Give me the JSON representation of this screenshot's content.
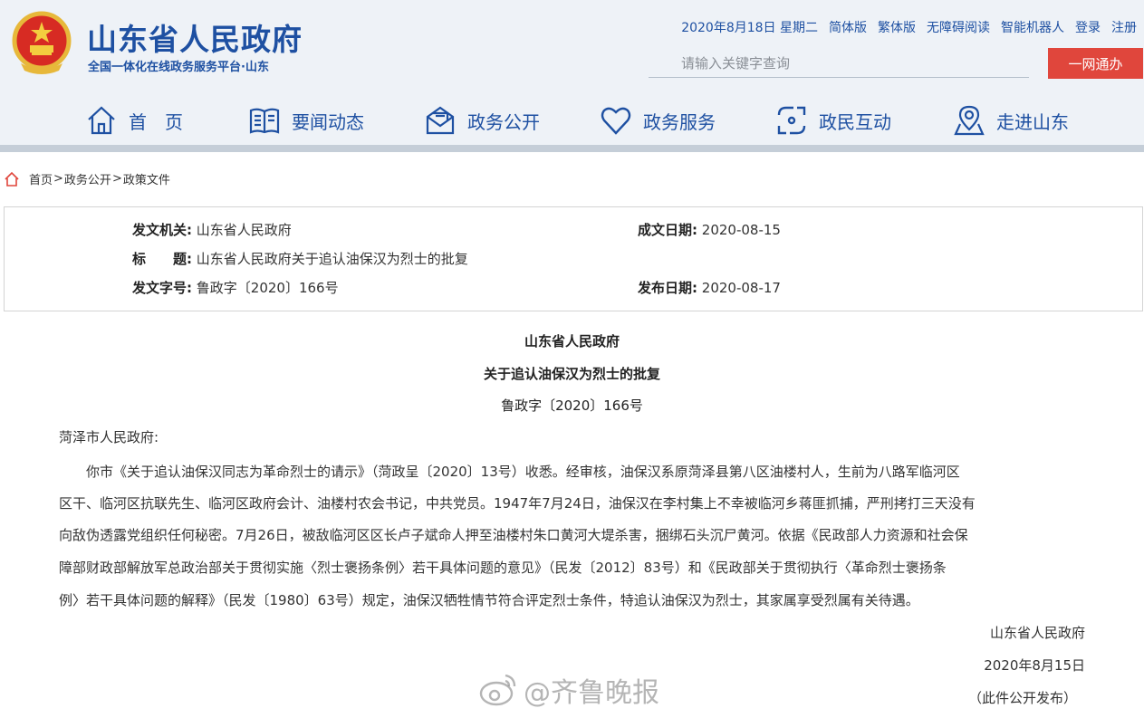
{
  "header": {
    "title": "山东省人民政府",
    "subtitle": "全国一体化在线政务服务平台·山东",
    "date": "2020年8月18日 星期二",
    "links": [
      "简体版",
      "繁体版",
      "无障碍阅读",
      "智能机器人",
      "登录",
      "注册"
    ],
    "search_placeholder": "请输入关键字查询",
    "go_button": "一网通办"
  },
  "nav": [
    {
      "label": "首　页",
      "icon": "home-icon"
    },
    {
      "label": "要闻动态",
      "icon": "book-icon"
    },
    {
      "label": "政务公开",
      "icon": "mail-icon"
    },
    {
      "label": "政务服务",
      "icon": "heart-icon"
    },
    {
      "label": "政民互动",
      "icon": "interact-icon"
    },
    {
      "label": "走进山东",
      "icon": "map-pin-icon"
    }
  ],
  "breadcrumb": [
    "首页",
    "政务公开",
    "政策文件"
  ],
  "meta": {
    "issuer_label": "发文机关:",
    "issuer": "山东省人民政府",
    "written_label": "成文日期:",
    "written": "2020-08-15",
    "title_label": "标　　题:",
    "title": "山东省人民政府关于追认油保汉为烈士的批复",
    "docno_label": "发文字号:",
    "docno": "鲁政字〔2020〕166号",
    "published_label": "发布日期:",
    "published": "2020-08-17"
  },
  "document": {
    "heading1": "山东省人民政府",
    "heading2": "关于追认油保汉为烈士的批复",
    "docno": "鲁政字〔2020〕166号",
    "salutation": "菏泽市人民政府:",
    "lines": [
      "　　你市《关于追认油保汉同志为革命烈士的请示》（菏政呈〔2020〕13号）收悉。经审核，油保汉系原菏泽县第八区油楼村人，生前为八路军临河区",
      "区干、临河区抗联先生、临河区政府会计、油楼村农会书记，中共党员。1947年7月24日，油保汉在李村集上不幸被临河乡蒋匪抓捕，严刑拷打三天没有",
      "向敌伪透露党组织任何秘密。7月26日，被敌临河区区长卢子斌命人押至油楼村朱口黄河大堤杀害，捆绑石头沉尸黄河。依据《民政部人力资源和社会保",
      "障部财政部解放军总政治部关于贯彻实施〈烈士褒扬条例〉若干具体问题的意见》（民发〔2012〕83号）和《民政部关于贯彻执行〈革命烈士褒扬条",
      "例〉若干具体问题的解释》（民发〔1980〕63号）规定，油保汉牺牲情节符合评定烈士条件，特追认油保汉为烈士，其家属享受烈属有关待遇。"
    ],
    "signer": "山东省人民政府",
    "sign_date": "2020年8月15日",
    "note": "（此件公开发布）"
  },
  "watermark": "@齐鲁晚报",
  "colors": {
    "brand": "#1e50a2",
    "accent": "#e0463c"
  }
}
